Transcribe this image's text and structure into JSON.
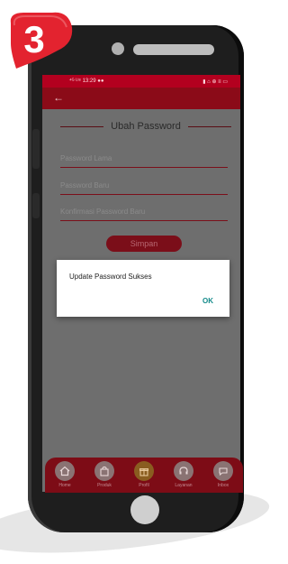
{
  "badge": {
    "number": "3",
    "color": "#e3232f"
  },
  "status_bar": {
    "time": "13:29",
    "left_text": "⁴ᴳ ᴸᵗᵉ",
    "right_text": "▮ ⌂ ⊕ ≡ ▭"
  },
  "page": {
    "title": "Ubah Password"
  },
  "form": {
    "old_password_placeholder": "Password Lama",
    "new_password_placeholder": "Password Baru",
    "confirm_password_placeholder": "Konfirmasi Password Baru",
    "submit_label": "Simpan"
  },
  "dialog": {
    "message": "Update Password Sukses",
    "ok_label": "OK"
  },
  "nav": {
    "items": [
      {
        "label": "Home",
        "icon": "home-icon"
      },
      {
        "label": "Produk",
        "icon": "bag-icon"
      },
      {
        "label": "Profil",
        "icon": "gift-icon"
      },
      {
        "label": "Layanan",
        "icon": "headset-icon"
      },
      {
        "label": "Inbox",
        "icon": "chat-icon"
      }
    ]
  },
  "colors": {
    "primary": "#b3001f",
    "appbar": "#8b0b18",
    "accent_ok": "#138a8a"
  }
}
